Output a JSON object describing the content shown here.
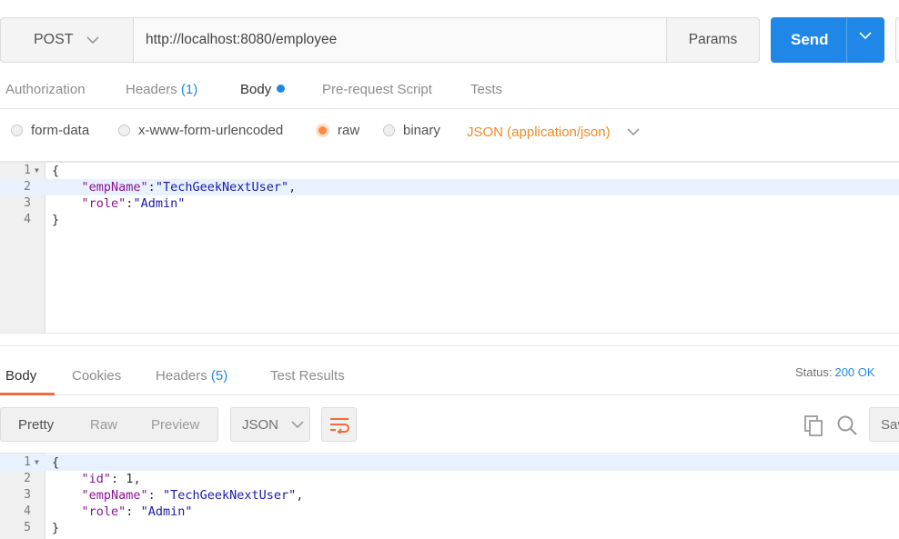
{
  "request": {
    "method": "POST",
    "url": "http://localhost:8080/employee",
    "params_label": "Params",
    "send_label": "Send"
  },
  "request_tabs": [
    {
      "label": "Authorization"
    },
    {
      "label": "Headers",
      "count": "(1)"
    },
    {
      "label": "Body"
    },
    {
      "label": "Pre-request Script"
    },
    {
      "label": "Tests"
    }
  ],
  "body_types": {
    "form_data": "form-data",
    "urlencoded": "x-www-form-urlencoded",
    "raw": "raw",
    "binary": "binary",
    "content_type": "JSON (application/json)"
  },
  "request_body": {
    "line_numbers": [
      "1",
      "2",
      "3",
      "4"
    ],
    "open_brace": "{",
    "close_brace": "}",
    "key1": "\"empName\"",
    "sep1": ":",
    "val1": "\"TechGeekNextUser\"",
    "comma": ",",
    "key2": "\"role\"",
    "sep2": ":",
    "val2": "\"Admin\""
  },
  "response_tabs": [
    {
      "label": "Body"
    },
    {
      "label": "Cookies"
    },
    {
      "label": "Headers",
      "count": "(5)"
    },
    {
      "label": "Test Results"
    }
  ],
  "status": {
    "label": "Status:",
    "value": "200 OK"
  },
  "view_modes": {
    "pretty": "Pretty",
    "raw": "Raw",
    "preview": "Preview"
  },
  "format": "JSON",
  "save_label": "Save",
  "response_body": {
    "line_numbers": [
      "1",
      "2",
      "3",
      "4",
      "5"
    ],
    "open_brace": "{",
    "close_brace": "}",
    "key_id": "\"id\"",
    "val_id": "1",
    "key_name": "\"empName\"",
    "val_name": "\"TechGeekNextUser\"",
    "key_role": "\"role\"",
    "val_role": "\"Admin\"",
    "colon": ": ",
    "comma": ","
  },
  "colors": {
    "accent_blue": "#1f87e8",
    "accent_orange": "#f08a24",
    "active_underline": "#f26b3a"
  }
}
